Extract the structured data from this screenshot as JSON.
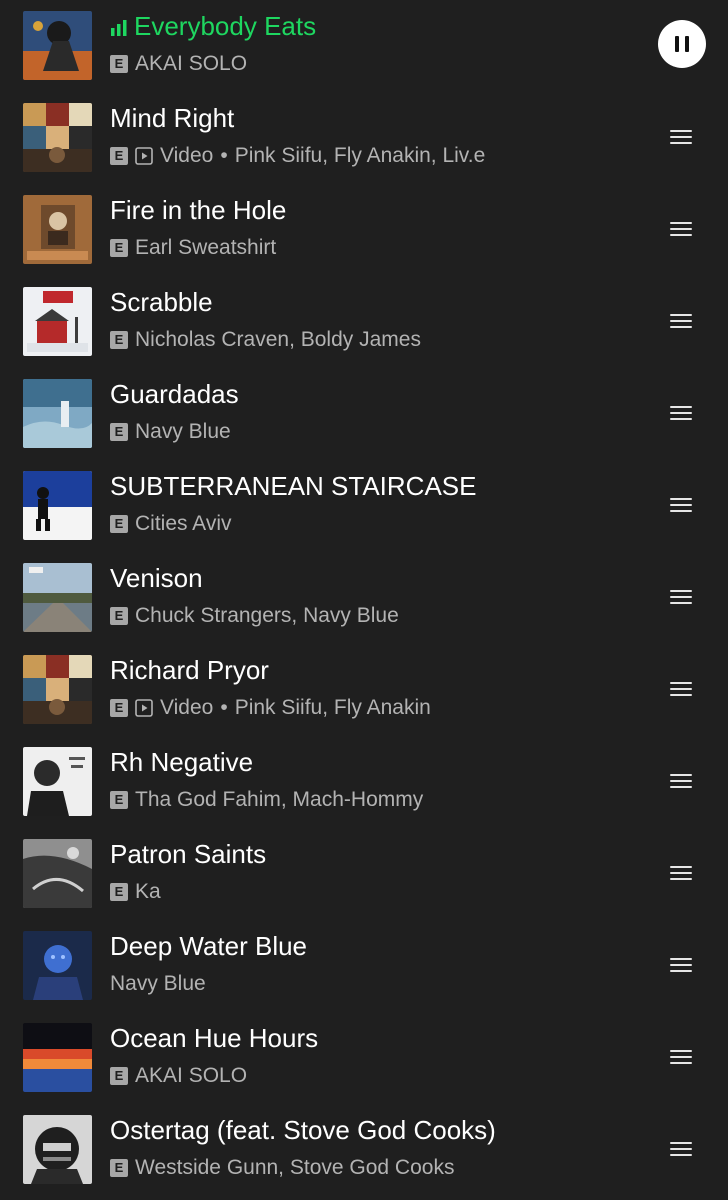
{
  "now_playing": {
    "title": "Everybody Eats",
    "artists": "AKAI SOLO",
    "explicit": "E",
    "accent_color": "#1ed760",
    "icon": "equalizer-icon",
    "control": "pause-icon"
  },
  "queue": [
    {
      "title": "Mind Right",
      "explicit": "E",
      "video_label": "Video",
      "separator": "•",
      "artists": "Pink Siifu, Fly Anakin, Liv.e"
    },
    {
      "title": "Fire in the Hole",
      "explicit": "E",
      "artists": "Earl Sweatshirt"
    },
    {
      "title": "Scrabble",
      "explicit": "E",
      "artists": "Nicholas Craven, Boldy James"
    },
    {
      "title": "Guardadas",
      "explicit": "E",
      "artists": "Navy Blue"
    },
    {
      "title": "SUBTERRANEAN STAIRCASE",
      "explicit": "E",
      "artists": "Cities Aviv"
    },
    {
      "title": "Venison",
      "explicit": "E",
      "artists": "Chuck Strangers, Navy Blue"
    },
    {
      "title": "Richard Pryor",
      "explicit": "E",
      "video_label": "Video",
      "separator": "•",
      "artists": "Pink Siifu, Fly Anakin"
    },
    {
      "title": "Rh Negative",
      "explicit": "E",
      "artists": "Tha God Fahim, Mach-Hommy"
    },
    {
      "title": "Patron Saints",
      "explicit": "E",
      "artists": "Ka"
    },
    {
      "title": "Deep Water Blue",
      "artists": "Navy Blue"
    },
    {
      "title": "Ocean Hue Hours",
      "explicit": "E",
      "artists": "AKAI SOLO"
    },
    {
      "title": "Ostertag (feat. Stove God Cooks)",
      "explicit": "E",
      "artists": "Westside Gunn, Stove God Cooks"
    }
  ],
  "icons": {
    "reorder": "drag-handle-icon",
    "video": "video-icon",
    "explicit": "explicit-badge"
  },
  "colors": {
    "background": "#1f1f1f",
    "title": "#ffffff",
    "subtitle": "#b3b3b3",
    "playing": "#1ed760"
  }
}
